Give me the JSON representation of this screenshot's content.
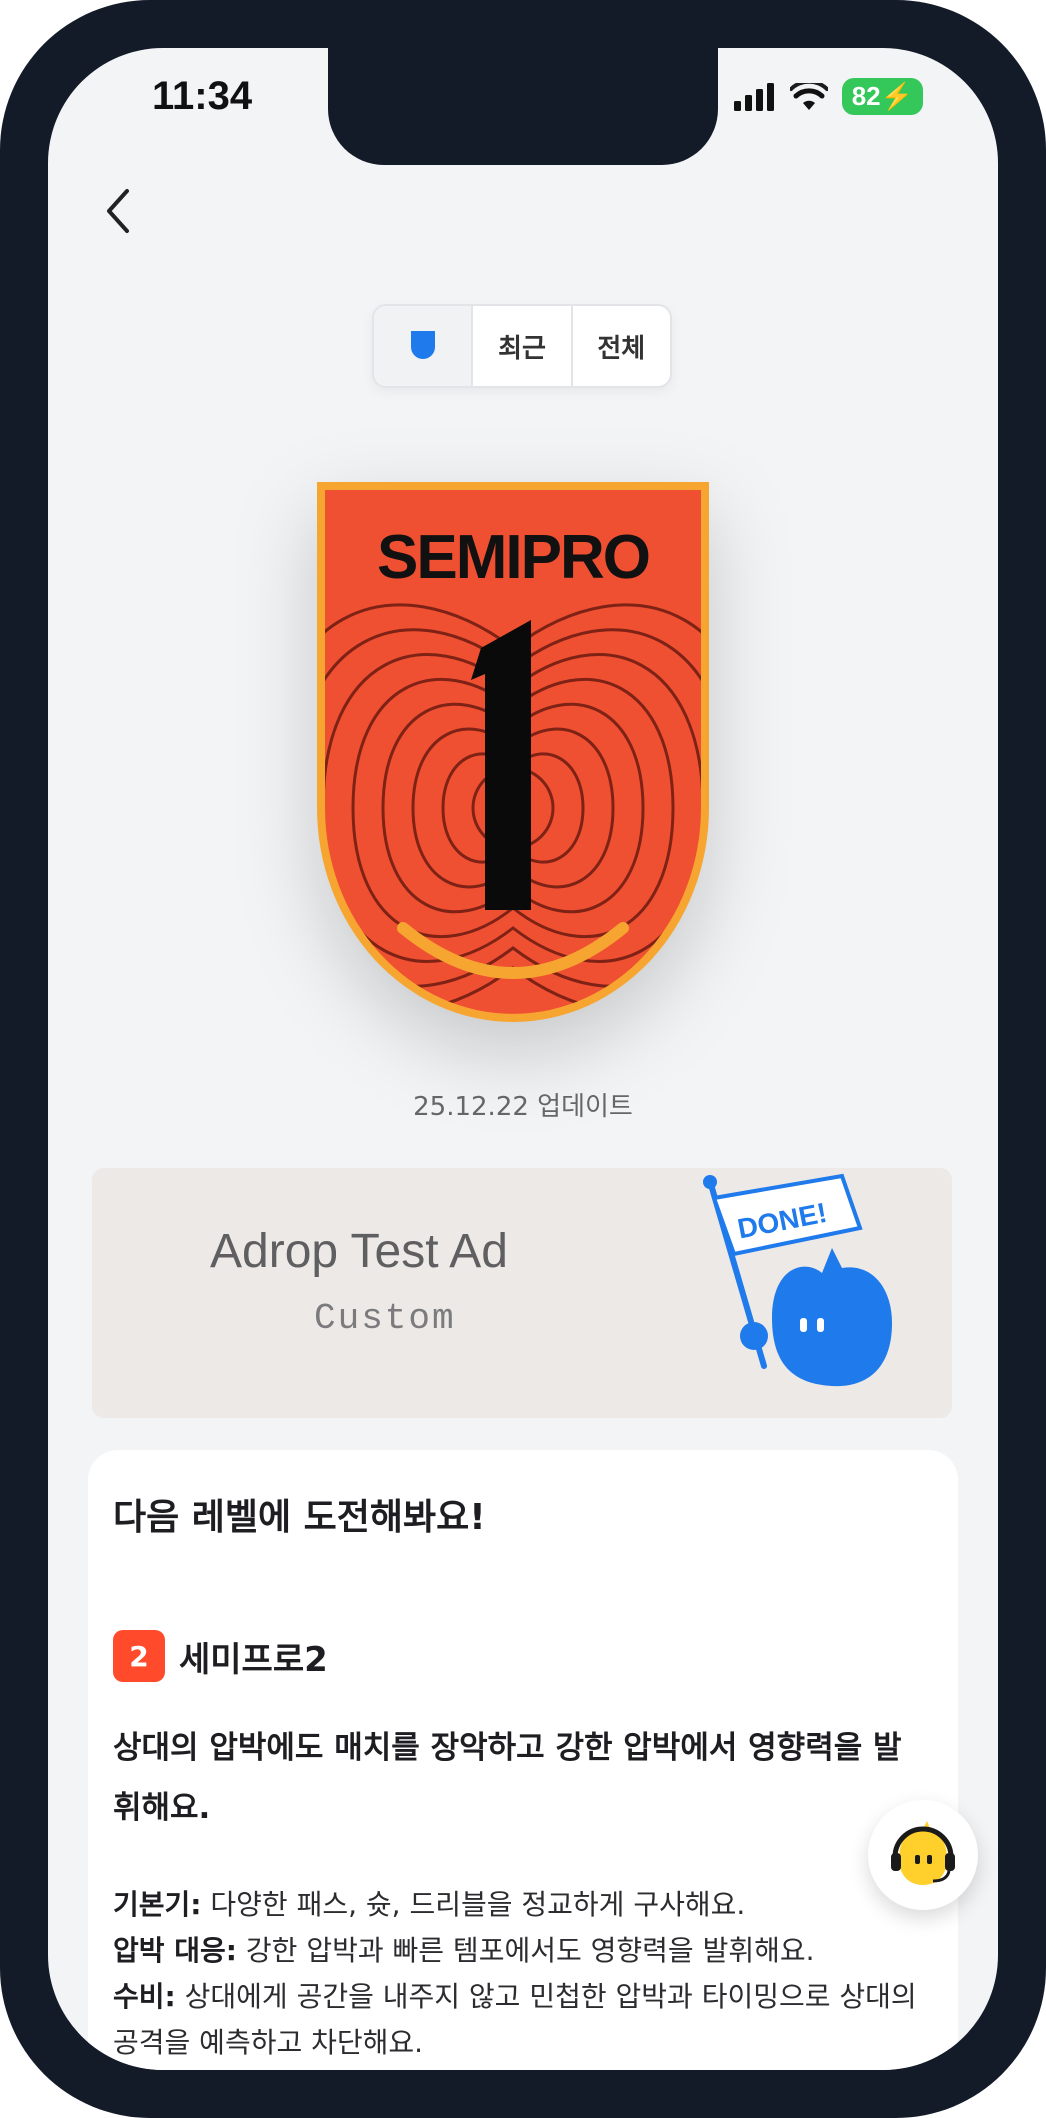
{
  "status_bar": {
    "time": "11:34",
    "battery": "82"
  },
  "tabs": [
    {
      "icon": "shield-icon"
    },
    {
      "label": "최근"
    },
    {
      "label": "전체"
    }
  ],
  "badge": {
    "name": "SEMIPRO",
    "level": "1",
    "color": "#f05032",
    "border_color": "#f7a531"
  },
  "update_date": "25.12.22 업데이트",
  "ad": {
    "title": "Adrop Test Ad",
    "subtitle": "Custom",
    "sticker": "DONE!"
  },
  "next_level": {
    "heading": "다음 레벨에 도전해봐요!",
    "number": "2",
    "name": "세미프로2",
    "description": "상대의 압박에도 매치를 장악하고 강한 압박에서 영향력을 발휘해요.",
    "skills": [
      {
        "label": "기본기:",
        "text": "다양한 패스, 슛, 드리블을 정교하게 구사해요."
      },
      {
        "label": "압박 대응:",
        "text": "강한 압박과 빠른 템포에서도 영향력을 발휘해요."
      },
      {
        "label": "수비:",
        "text": "상대에게 공간을 내주지 않고 민첩한 압박과 타이밍으로 상대의 공격을 예측하고 차단해요."
      }
    ]
  },
  "colors": {
    "accent": "#ff4b2b",
    "mascot_blue": "#1f7aec"
  }
}
